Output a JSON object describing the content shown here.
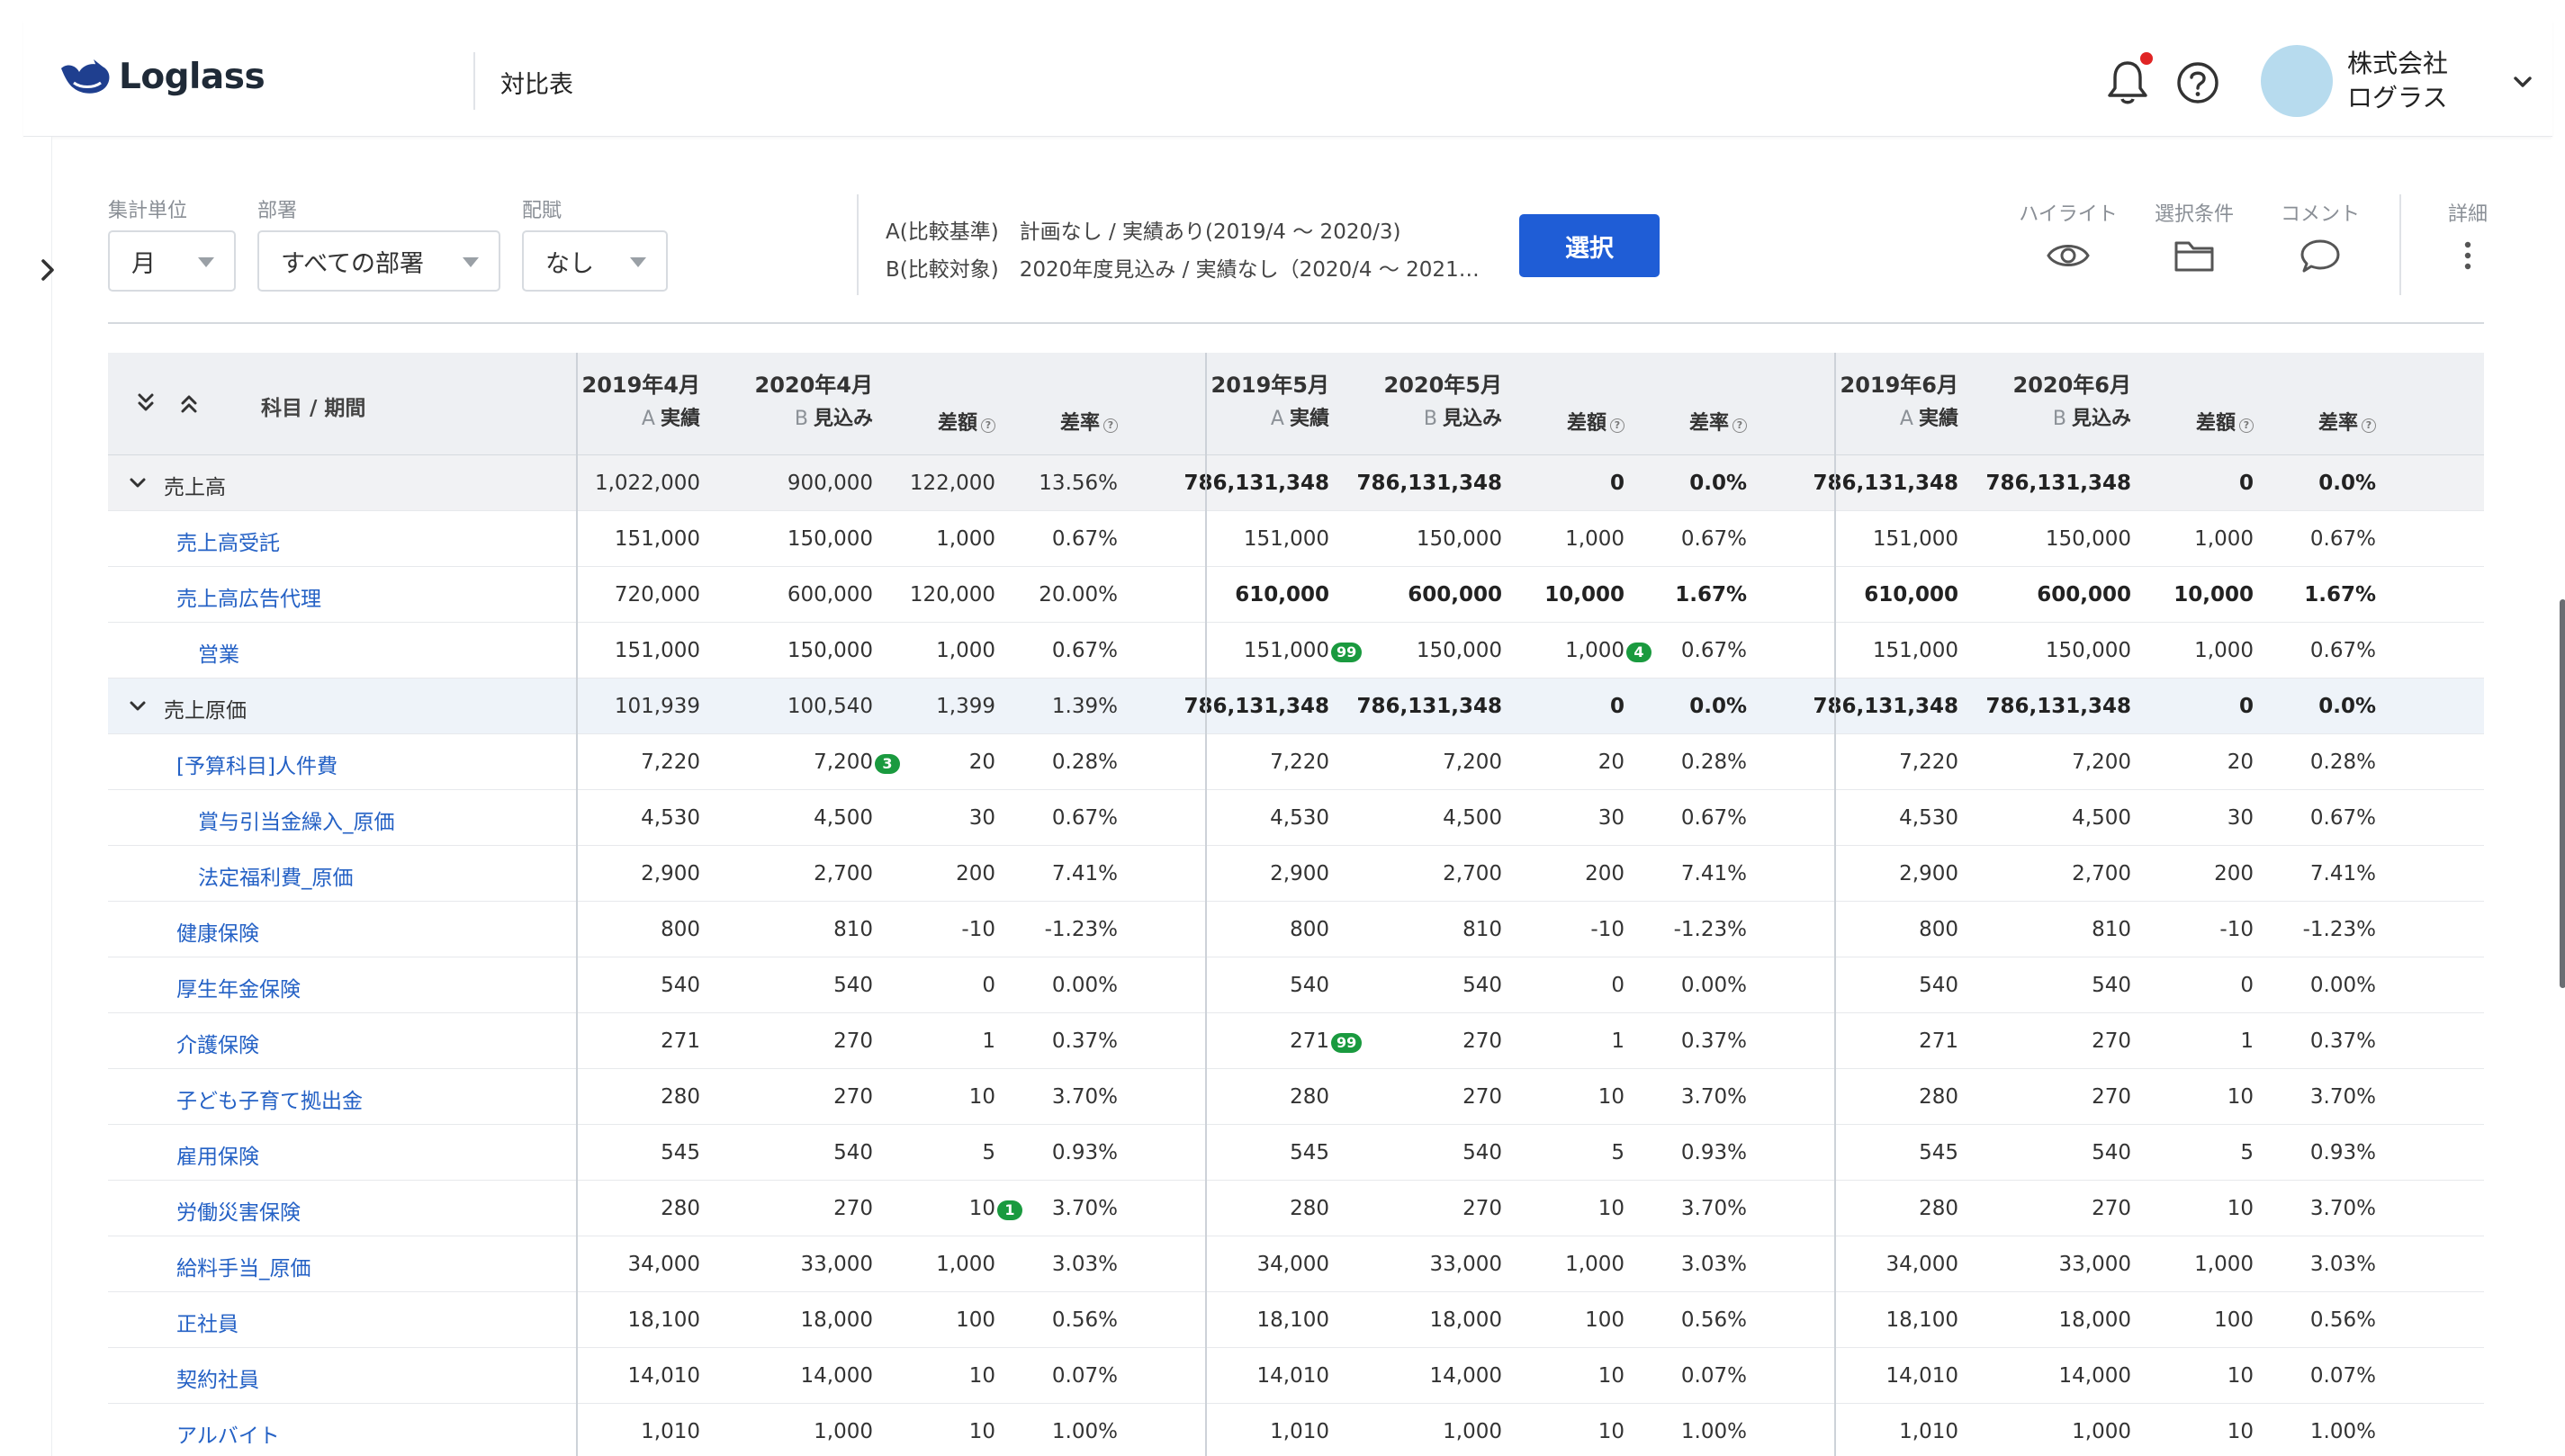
{
  "header": {
    "brand": "Loglass",
    "page_title": "対比表",
    "company_line1": "株式会社",
    "company_line2": "ログラス"
  },
  "filters": {
    "unit": {
      "label": "集計単位",
      "value": "月"
    },
    "department": {
      "label": "部署",
      "value": "すべての部署"
    },
    "allocation": {
      "label": "配賦",
      "value": "なし"
    },
    "comparison_a": "A(比較基準)　計画なし / 実績あり(2019/4 〜 2020/3)",
    "comparison_b": "B(比較対象)　2020年度見込み / 実績なし（2020/4 〜 2021…",
    "select_button": "選択",
    "tools": [
      "ハイライト",
      "選択条件",
      "コメント",
      "詳細"
    ]
  },
  "table": {
    "subject_header": "科目 / 期間",
    "months": [
      {
        "a_label": "2019年4月",
        "b_label": "2020年4月"
      },
      {
        "a_label": "2019年5月",
        "b_label": "2020年5月"
      },
      {
        "a_label": "2019年6月",
        "b_label": "2020年6月"
      }
    ],
    "a_prefix": "A",
    "a_sub": "実績",
    "b_prefix": "B",
    "b_sub": "見込み",
    "diff_label": "差額",
    "rate_label": "差率",
    "rows": [
      {
        "name": "売上高",
        "indent": 0,
        "expand": true,
        "group": true,
        "bold_groups": [
          1,
          2
        ],
        "values": [
          [
            "1,022,000",
            "900,000",
            "122,000",
            "13.56%"
          ],
          [
            "786,131,348",
            "786,131,348",
            "0",
            "0.0%"
          ],
          [
            "786,131,348",
            "786,131,348",
            "0",
            "0.0%"
          ]
        ]
      },
      {
        "name": "売上高受託",
        "indent": 1,
        "values": [
          [
            "151,000",
            "150,000",
            "1,000",
            "0.67%"
          ],
          [
            "151,000",
            "150,000",
            "1,000",
            "0.67%"
          ],
          [
            "151,000",
            "150,000",
            "1,000",
            "0.67%"
          ]
        ]
      },
      {
        "name": "売上高広告代理",
        "indent": 1,
        "bold_groups": [
          1,
          2
        ],
        "values": [
          [
            "720,000",
            "600,000",
            "120,000",
            "20.00%"
          ],
          [
            "610,000",
            "600,000",
            "10,000",
            "1.67%"
          ],
          [
            "610,000",
            "600,000",
            "10,000",
            "1.67%"
          ]
        ]
      },
      {
        "name": "営業",
        "indent": 2,
        "values": [
          [
            "151,000",
            "150,000",
            "1,000",
            "0.67%"
          ],
          [
            "151,000",
            "150,000",
            "1,000",
            "0.67%"
          ],
          [
            "151,000",
            "150,000",
            "1,000",
            "0.67%"
          ]
        ],
        "badges": [
          {
            "group": 1,
            "col": 0,
            "text": "99"
          },
          {
            "group": 1,
            "col": 2,
            "text": "4"
          }
        ]
      },
      {
        "name": "売上原価",
        "indent": 0,
        "expand": true,
        "highlight": true,
        "bold_groups": [
          1,
          2
        ],
        "values": [
          [
            "101,939",
            "100,540",
            "1,399",
            "1.39%"
          ],
          [
            "786,131,348",
            "786,131,348",
            "0",
            "0.0%"
          ],
          [
            "786,131,348",
            "786,131,348",
            "0",
            "0.0%"
          ]
        ]
      },
      {
        "name": "[予算科目]人件費",
        "indent": 1,
        "values": [
          [
            "7,220",
            "7,200",
            "20",
            "0.28%"
          ],
          [
            "7,220",
            "7,200",
            "20",
            "0.28%"
          ],
          [
            "7,220",
            "7,200",
            "20",
            "0.28%"
          ]
        ],
        "badges": [
          {
            "group": 0,
            "col": 1,
            "text": "3"
          }
        ]
      },
      {
        "name": "賞与引当金繰入_原価",
        "indent": 2,
        "values": [
          [
            "4,530",
            "4,500",
            "30",
            "0.67%"
          ],
          [
            "4,530",
            "4,500",
            "30",
            "0.67%"
          ],
          [
            "4,530",
            "4,500",
            "30",
            "0.67%"
          ]
        ]
      },
      {
        "name": "法定福利費_原価",
        "indent": 2,
        "values": [
          [
            "2,900",
            "2,700",
            "200",
            "7.41%"
          ],
          [
            "2,900",
            "2,700",
            "200",
            "7.41%"
          ],
          [
            "2,900",
            "2,700",
            "200",
            "7.41%"
          ]
        ]
      },
      {
        "name": "健康保険",
        "indent": 1,
        "values": [
          [
            "800",
            "810",
            "-10",
            "-1.23%"
          ],
          [
            "800",
            "810",
            "-10",
            "-1.23%"
          ],
          [
            "800",
            "810",
            "-10",
            "-1.23%"
          ]
        ]
      },
      {
        "name": "厚生年金保険",
        "indent": 1,
        "values": [
          [
            "540",
            "540",
            "0",
            "0.00%"
          ],
          [
            "540",
            "540",
            "0",
            "0.00%"
          ],
          [
            "540",
            "540",
            "0",
            "0.00%"
          ]
        ]
      },
      {
        "name": "介護保険",
        "indent": 1,
        "values": [
          [
            "271",
            "270",
            "1",
            "0.37%"
          ],
          [
            "271",
            "270",
            "1",
            "0.37%"
          ],
          [
            "271",
            "270",
            "1",
            "0.37%"
          ]
        ],
        "badges": [
          {
            "group": 1,
            "col": 0,
            "text": "99"
          }
        ]
      },
      {
        "name": "子ども子育て拠出金",
        "indent": 1,
        "values": [
          [
            "280",
            "270",
            "10",
            "3.70%"
          ],
          [
            "280",
            "270",
            "10",
            "3.70%"
          ],
          [
            "280",
            "270",
            "10",
            "3.70%"
          ]
        ]
      },
      {
        "name": "雇用保険",
        "indent": 1,
        "values": [
          [
            "545",
            "540",
            "5",
            "0.93%"
          ],
          [
            "545",
            "540",
            "5",
            "0.93%"
          ],
          [
            "545",
            "540",
            "5",
            "0.93%"
          ]
        ]
      },
      {
        "name": "労働災害保険",
        "indent": 1,
        "values": [
          [
            "280",
            "270",
            "10",
            "3.70%"
          ],
          [
            "280",
            "270",
            "10",
            "3.70%"
          ],
          [
            "280",
            "270",
            "10",
            "3.70%"
          ]
        ],
        "badges": [
          {
            "group": 0,
            "col": 2,
            "text": "1"
          }
        ]
      },
      {
        "name": "給料手当_原価",
        "indent": 1,
        "values": [
          [
            "34,000",
            "33,000",
            "1,000",
            "3.03%"
          ],
          [
            "34,000",
            "33,000",
            "1,000",
            "3.03%"
          ],
          [
            "34,000",
            "33,000",
            "1,000",
            "3.03%"
          ]
        ]
      },
      {
        "name": "正社員",
        "indent": 1,
        "values": [
          [
            "18,100",
            "18,000",
            "100",
            "0.56%"
          ],
          [
            "18,100",
            "18,000",
            "100",
            "0.56%"
          ],
          [
            "18,100",
            "18,000",
            "100",
            "0.56%"
          ]
        ]
      },
      {
        "name": "契約社員",
        "indent": 1,
        "values": [
          [
            "14,010",
            "14,000",
            "10",
            "0.07%"
          ],
          [
            "14,010",
            "14,000",
            "10",
            "0.07%"
          ],
          [
            "14,010",
            "14,000",
            "10",
            "0.07%"
          ]
        ]
      },
      {
        "name": "アルバイト",
        "indent": 1,
        "values": [
          [
            "1,010",
            "1,000",
            "10",
            "1.00%"
          ],
          [
            "1,010",
            "1,000",
            "10",
            "1.00%"
          ],
          [
            "1,010",
            "1,000",
            "10",
            "1.00%"
          ]
        ]
      }
    ]
  },
  "colors": {
    "primary": "#1f5dd6",
    "link": "#2461c5",
    "badge": "#1a9a3f",
    "notification": "#e02424"
  }
}
